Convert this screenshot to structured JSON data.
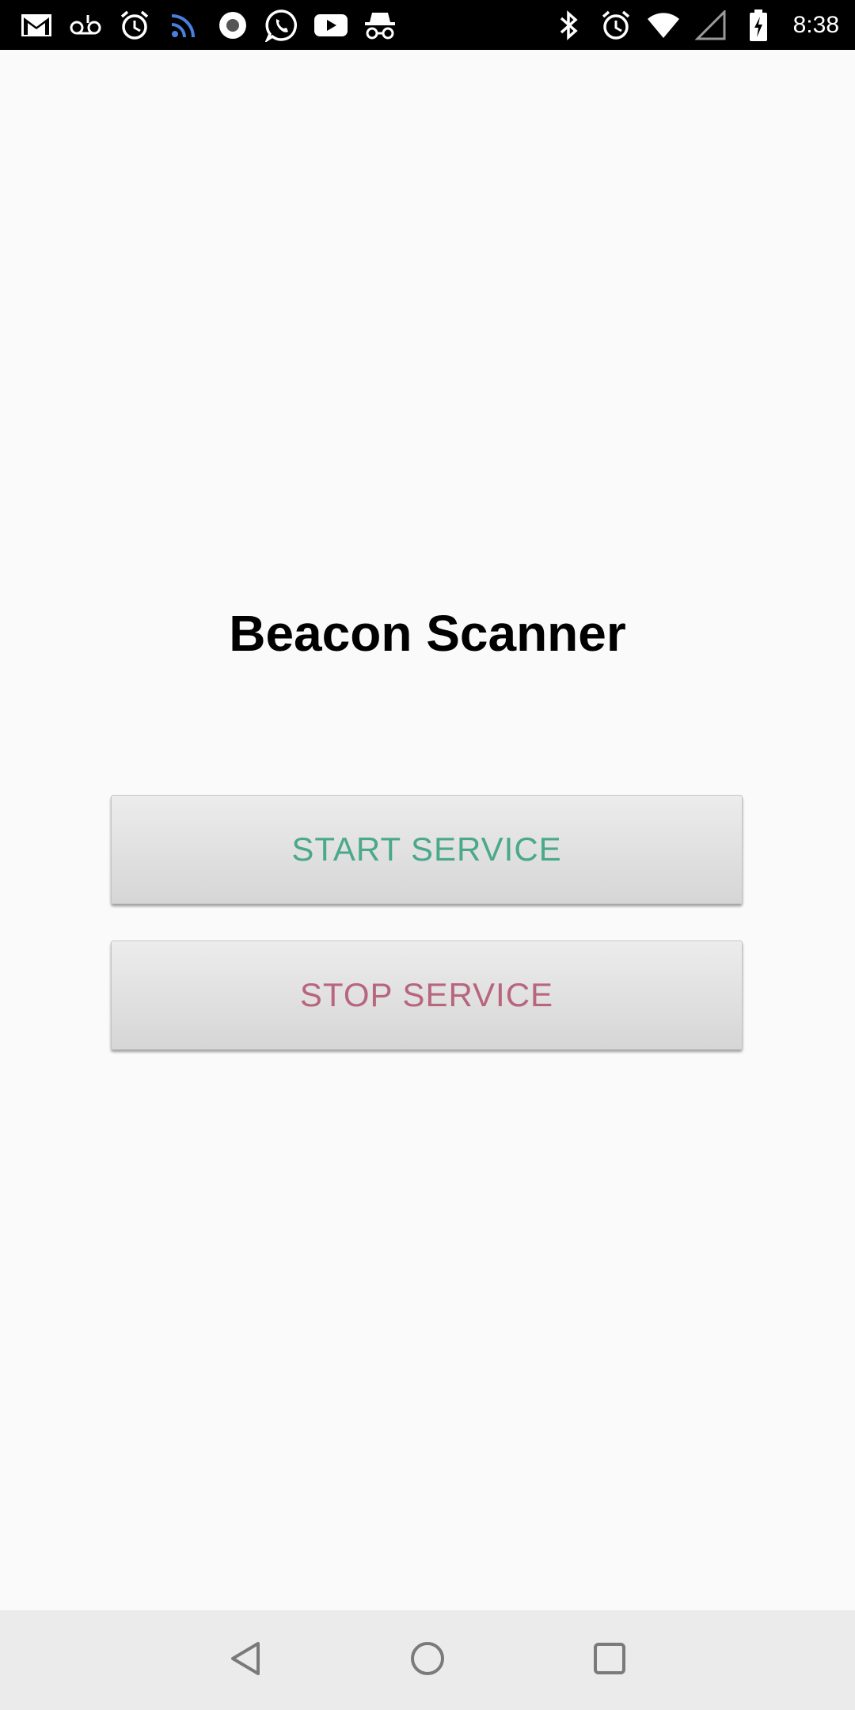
{
  "status_bar": {
    "time": "8:38",
    "left_icons": [
      "gmail-icon",
      "voicemail-icon",
      "alarm-icon",
      "rss-feed-icon",
      "record-icon",
      "whatsapp-icon",
      "youtube-icon",
      "incognito-icon"
    ],
    "right_icons": [
      "bluetooth-icon",
      "alarm-icon",
      "wifi-icon",
      "cell-signal-icon",
      "battery-charging-icon"
    ]
  },
  "main": {
    "title": "Beacon Scanner",
    "start_button_label": "START SERVICE",
    "stop_button_label": "STOP SERVICE"
  },
  "colors": {
    "start": "#4aa88b",
    "stop": "#b8657e",
    "rss": "#4a7fe0"
  },
  "nav_bar": {
    "buttons": [
      "back-icon",
      "home-icon",
      "recent-apps-icon"
    ]
  }
}
